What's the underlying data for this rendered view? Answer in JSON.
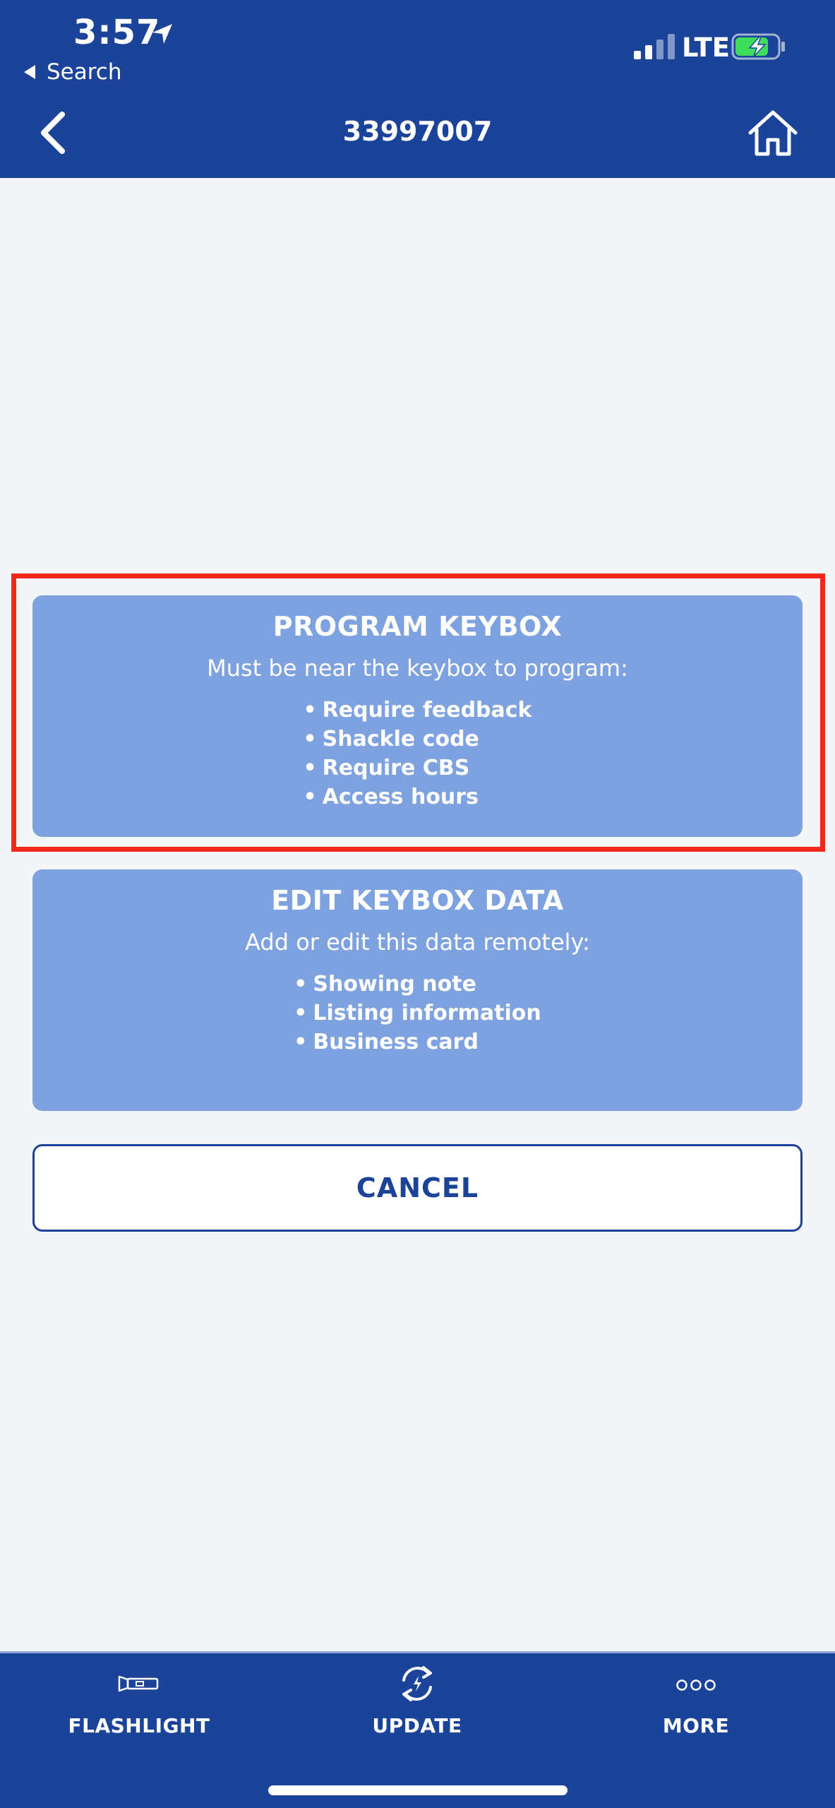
{
  "status_bar": {
    "time": "3:57",
    "back_app": "Search",
    "network": "LTE"
  },
  "nav": {
    "title": "33997007"
  },
  "program_card": {
    "title": "PROGRAM KEYBOX",
    "subtitle": "Must be near the keybox to program:",
    "items": [
      "Require feedback",
      "Shackle code",
      "Require CBS",
      "Access hours"
    ]
  },
  "edit_card": {
    "title": "EDIT KEYBOX DATA",
    "subtitle": "Add or edit this data remotely:",
    "items": [
      "Showing note",
      "Listing information",
      "Business card"
    ]
  },
  "cancel_label": "CANCEL",
  "tabbar": {
    "items": [
      {
        "label": "FLASHLIGHT",
        "icon": "flashlight-icon"
      },
      {
        "label": "UPDATE",
        "icon": "refresh-icon"
      },
      {
        "label": "MORE",
        "icon": "more-dots-icon"
      }
    ]
  },
  "colors": {
    "header_bg": "#1b4399",
    "card_bg": "#7da2df",
    "highlight_border": "#f0281a",
    "page_bg": "#f3f5f8"
  }
}
